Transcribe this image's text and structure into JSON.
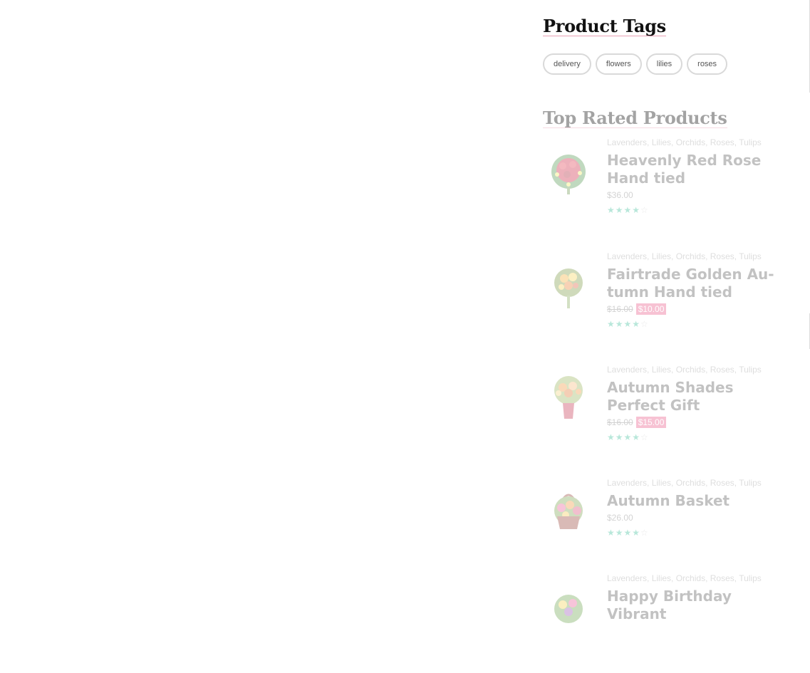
{
  "product_tags": {
    "title": "Product Tags",
    "tags": [
      "delivery",
      "flowers",
      "lilies",
      "roses"
    ]
  },
  "top_rated": {
    "title": "Top Rated Products",
    "products": [
      {
        "categories": "Lavenders, Lilies, Orchids, Roses, Tulips",
        "name": "Heavenly Red Rose Hand tied",
        "price": "$36.00",
        "old_price": "",
        "sale_price": "",
        "rating": 4,
        "image": "red-rose-bouquet"
      },
      {
        "categories": "Lavenders, Lilies, Orchids, Roses, Tulips",
        "name": "Fairtrade Golden Au-tumn Hand tied",
        "price": "",
        "old_price": "$16.00",
        "sale_price": "$10.00",
        "rating": 4,
        "image": "golden-autumn-bouquet"
      },
      {
        "categories": "Lavenders, Lilies, Orchids, Roses, Tulips",
        "name": "Autumn Shades Perfect Gift",
        "price": "",
        "old_price": "$16.00",
        "sale_price": "$15.00",
        "rating": 4,
        "image": "orange-vase-bouquet"
      },
      {
        "categories": "Lavenders, Lilies, Orchids, Roses, Tulips",
        "name": "Autumn Basket",
        "price": "$26.00",
        "old_price": "",
        "sale_price": "",
        "rating": 4,
        "image": "flower-basket"
      },
      {
        "categories": "Lavenders, Lilies, Orchids, Roses, Tulips",
        "name": "Happy Birthday Vibrant",
        "price": "",
        "old_price": "",
        "sale_price": "",
        "rating": 0,
        "image": "vibrant-bouquet"
      }
    ]
  },
  "colors": {
    "accent": "#e8447a",
    "star": "#27b88e",
    "title_underline": "#e8a0b4"
  }
}
